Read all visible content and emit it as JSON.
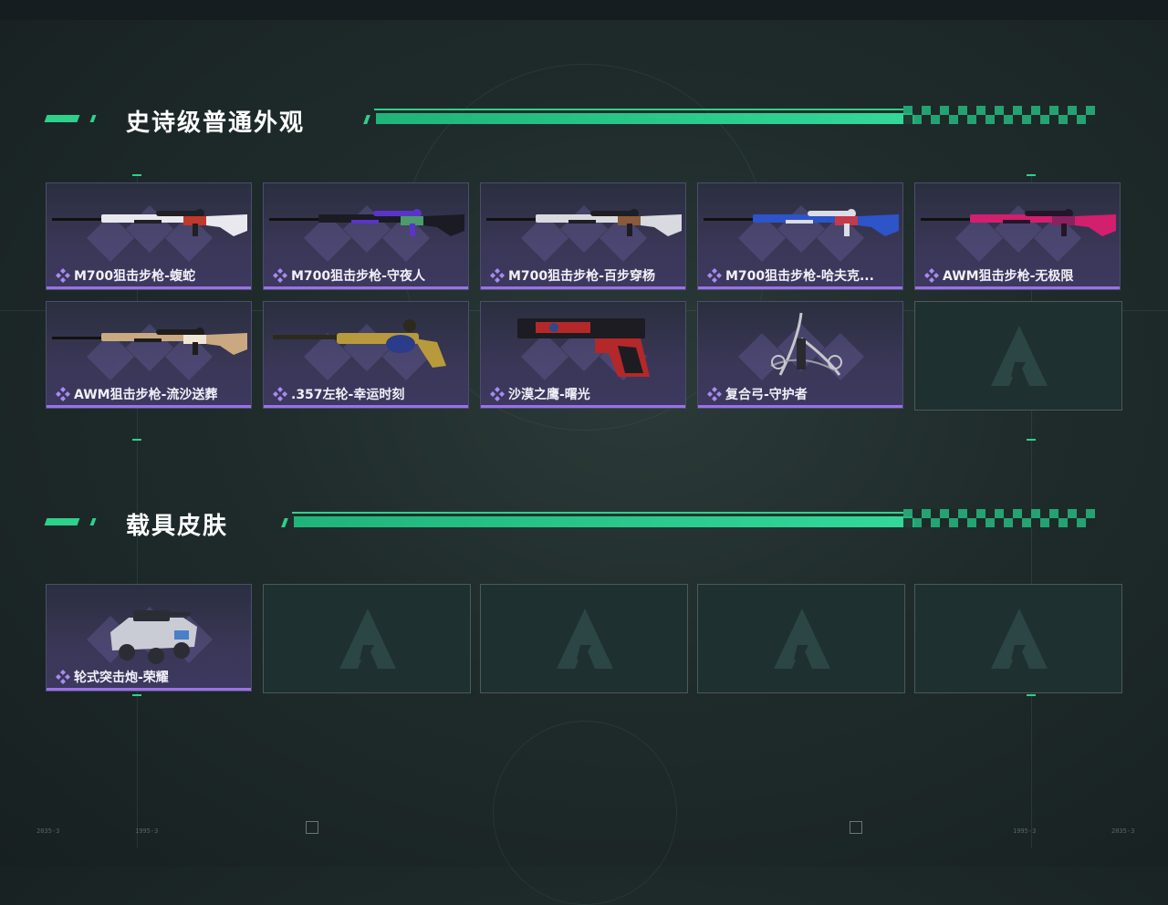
{
  "sections": [
    {
      "title": "史诗级普通外观",
      "items": [
        {
          "label": "M700狙击步枪-蝮蛇",
          "icon": "sniper-rifle-icon",
          "colors": [
            "#e8e8ee",
            "#202025",
            "#c0392b"
          ]
        },
        {
          "label": "M700狙击步枪-守夜人",
          "icon": "sniper-rifle-icon",
          "colors": [
            "#1b1b24",
            "#5a34c8",
            "#4a9c6d"
          ]
        },
        {
          "label": "M700狙击步枪-百步穿杨",
          "icon": "sniper-rifle-icon",
          "colors": [
            "#d9d9e0",
            "#1e1e24",
            "#8a5a3a"
          ]
        },
        {
          "label": "M700狙击步枪-哈夫克...",
          "icon": "sniper-rifle-icon",
          "colors": [
            "#2d54c8",
            "#dcdde6",
            "#c33b4b"
          ]
        },
        {
          "label": "AWM狙击步枪-无极限",
          "icon": "sniper-rifle-icon",
          "colors": [
            "#d21f6e",
            "#25152a",
            "#8a2260"
          ]
        },
        {
          "label": "AWM狙击步枪-流沙送葬",
          "icon": "sniper-rifle-icon",
          "colors": [
            "#caa982",
            "#1f1d1c",
            "#efe6d6"
          ]
        },
        {
          "label": ".357左轮-幸运时刻",
          "icon": "revolver-icon",
          "colors": [
            "#b89a3c",
            "#2c2a1c",
            "#2a3c8a"
          ]
        },
        {
          "label": "沙漠之鹰-曙光",
          "icon": "pistol-icon",
          "colors": [
            "#b4282a",
            "#1d1c22",
            "#2a4a8a"
          ]
        },
        {
          "label": "复合弓-守护者",
          "icon": "compound-bow-icon",
          "colors": [
            "#c6c6cc",
            "#2a2a30",
            "#9a9aa4"
          ]
        }
      ],
      "empty_slots": 1
    },
    {
      "title": "载具皮肤",
      "items": [
        {
          "label": "轮式突击炮-荣耀",
          "icon": "armored-vehicle-icon",
          "colors": [
            "#c9ccd4",
            "#2b2d34",
            "#4a80c8"
          ]
        }
      ],
      "empty_slots": 4
    }
  ],
  "hud": {
    "left_a": "2035-3",
    "left_b": "1995-3",
    "right_a": "1995-3",
    "right_b": "2035-3"
  },
  "theme": {
    "accent": "#2ed08c",
    "rarity_bar": "#9a72e6",
    "empty_slot": "#1e3030"
  }
}
